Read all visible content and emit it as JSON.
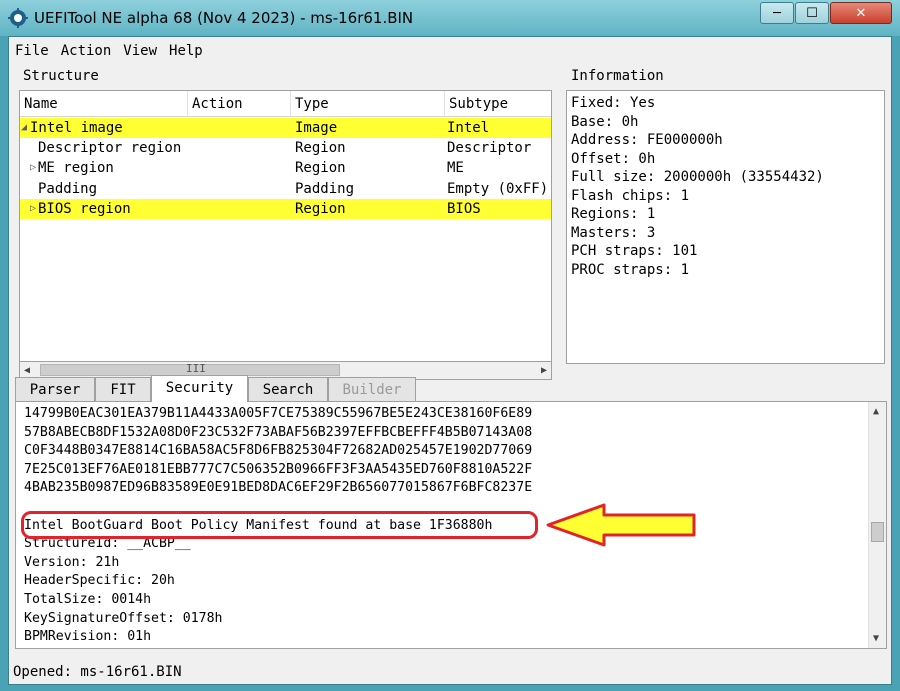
{
  "window": {
    "title": "UEFITool NE alpha 68 (Nov  4 2023) - ms-16r61.BIN",
    "min_glyph": "─",
    "max_glyph": "☐",
    "close_glyph": "✕"
  },
  "menu": [
    "File",
    "Action",
    "View",
    "Help"
  ],
  "structure": {
    "label": "Structure",
    "columns": [
      "Name",
      "Action",
      "Type",
      "Subtype"
    ],
    "rows": [
      {
        "name": "Intel image",
        "action": "",
        "type": "Image",
        "subtype": "Intel",
        "highlighted": true,
        "expander": "◢"
      },
      {
        "name": "Descriptor region",
        "action": "",
        "type": "Region",
        "subtype": "Descriptor",
        "highlighted": false,
        "expander": ""
      },
      {
        "name": "ME region",
        "action": "",
        "type": "Region",
        "subtype": "ME",
        "highlighted": false,
        "expander": "▷"
      },
      {
        "name": "Padding",
        "action": "",
        "type": "Padding",
        "subtype": "Empty (0xFF)",
        "highlighted": false,
        "expander": ""
      },
      {
        "name": "BIOS region",
        "action": "",
        "type": "Region",
        "subtype": "BIOS",
        "highlighted": true,
        "expander": "▷"
      }
    ],
    "scroll_left": "◀",
    "scroll_right": "▶",
    "scroll_grip": "III"
  },
  "information": {
    "label": "Information",
    "lines": [
      "Fixed: Yes",
      "Base: 0h",
      "Address: FE000000h",
      "Offset: 0h",
      "Full size: 2000000h (33554432)",
      "Flash chips: 1",
      "Regions: 1",
      "Masters: 3",
      "PCH straps: 101",
      "PROC straps: 1"
    ]
  },
  "tabs": [
    {
      "label": "Parser",
      "active": false,
      "disabled": false
    },
    {
      "label": "FIT",
      "active": false,
      "disabled": false
    },
    {
      "label": "Security",
      "active": true,
      "disabled": false
    },
    {
      "label": "Search",
      "active": false,
      "disabled": false
    },
    {
      "label": "Builder",
      "active": false,
      "disabled": true
    }
  ],
  "security": {
    "lines": [
      "14799B0EAC301EA379B11A4433A005F7CE75389C55967BE5E243CE38160F6E89",
      "57B8ABECB8DF1532A08D0F23C532F73ABAF56B2397EFFBCBEFFF4B5B07143A08",
      "C0F3448B0347E8814C16BA58AC5F8D6FB825304F72682AD025457E1902D77069",
      "7E25C013EF76AE0181EBB777C7C506352B0966FF3F3AA5435ED760F8810A522F",
      "4BAB235B0987ED96B83589E0E91BED8DAC6EF29F2B656077015867F6BFC8237E",
      "",
      "Intel BootGuard Boot Policy Manifest found at base 1F36880h",
      "StructureId: __ACBP__",
      "Version: 21h",
      "HeaderSpecific: 20h",
      "TotalSize: 0014h",
      "KeySignatureOffset: 0178h",
      "BPMRevision: 01h"
    ],
    "scroll_up": "▲",
    "scroll_down": "▼"
  },
  "status": "Opened: ms-16r61.BIN",
  "colors": {
    "highlight_row": "#ffff33",
    "annotation_red": "#e0242a",
    "arrow_fill": "#ffff33"
  }
}
